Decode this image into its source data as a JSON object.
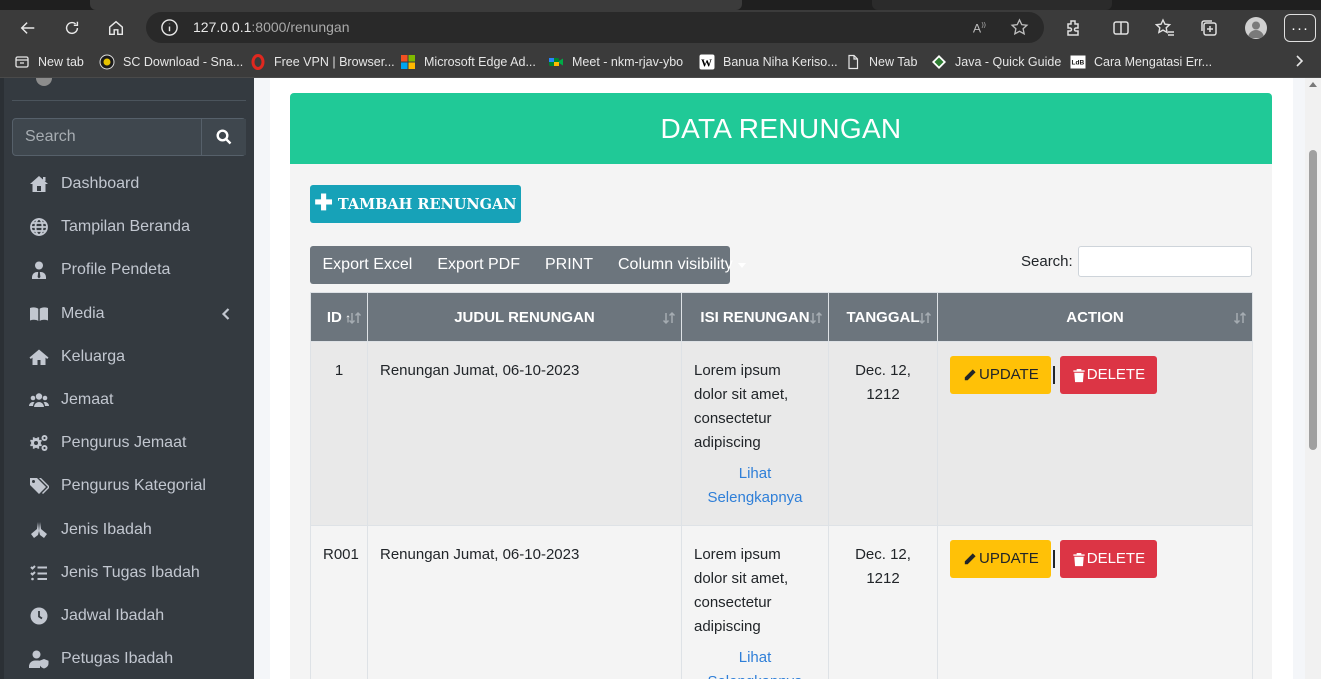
{
  "browser": {
    "url_host": "127.0.0.1",
    "url_path": ":8000/renungan",
    "more_label": "···",
    "bookmarks": [
      {
        "label": "New tab",
        "icon": "newtab-icon"
      },
      {
        "label": "SC Download - Sna...",
        "icon": "sc-download-icon"
      },
      {
        "label": "Free VPN | Browser...",
        "icon": "vpn-icon"
      },
      {
        "label": "Microsoft Edge Ad...",
        "icon": "microsoft-icon"
      },
      {
        "label": "Meet - nkm-rjav-ybo",
        "icon": "meet-icon"
      },
      {
        "label": "Banua Niha Keriso...",
        "icon": "wikipedia-icon"
      },
      {
        "label": "New Tab",
        "icon": "page-icon"
      },
      {
        "label": "Java - Quick Guide",
        "icon": "java-icon"
      },
      {
        "label": "Cara Mengatasi Err...",
        "icon": "sitelogo-icon"
      }
    ]
  },
  "sidebar": {
    "search_placeholder": "Search",
    "items": [
      {
        "label": "Dashboard",
        "icon": "dashboard-icon"
      },
      {
        "label": "Tampilan Beranda",
        "icon": "globe-icon"
      },
      {
        "label": "Profile Pendeta",
        "icon": "user-tie-icon"
      },
      {
        "label": "Media",
        "icon": "book-open-icon"
      },
      {
        "label": "Keluarga",
        "icon": "home-icon"
      },
      {
        "label": "Jemaat",
        "icon": "users-icon"
      },
      {
        "label": "Pengurus Jemaat",
        "icon": "cogs-icon"
      },
      {
        "label": "Pengurus Kategorial",
        "icon": "tags-icon"
      },
      {
        "label": "Jenis Ibadah",
        "icon": "praying-hands-icon"
      },
      {
        "label": "Jenis Tugas Ibadah",
        "icon": "tasks-icon"
      },
      {
        "label": "Jadwal Ibadah",
        "icon": "clock-icon"
      },
      {
        "label": "Petugas Ibadah",
        "icon": "user-shield-icon"
      }
    ]
  },
  "main": {
    "title": "DATA RENUNGAN",
    "add_button": "TAMBAH RENUNGAN",
    "export_buttons": {
      "excel": "Export Excel",
      "pdf": "Export PDF",
      "print": "PRINT",
      "colvis": "Column visibility"
    },
    "search_label": "Search:",
    "search_value": "",
    "columns": [
      "ID",
      "JUDUL RENUNGAN",
      "ISI RENUNGAN",
      "TANGGAL",
      "ACTION"
    ],
    "rows": [
      {
        "id": "1",
        "judul": "Renungan Jumat, 06-10-2023",
        "isi": "Lorem ipsum dolor sit amet, consectetur adipiscing",
        "link": "Lihat Selengkapnya",
        "tanggal": "Dec. 12, 1212",
        "update": "UPDATE",
        "delete": "DELETE"
      },
      {
        "id": "R001",
        "judul": "Renungan Jumat, 06-10-2023",
        "isi": "Lorem ipsum dolor sit amet, consectetur adipiscing",
        "link": "Lihat Selengkapnya",
        "tanggal": "Dec. 12, 1212",
        "update": "UPDATE",
        "delete": "DELETE"
      }
    ]
  },
  "colors": {
    "header_green": "#20c997",
    "add_button": "#17a2b8",
    "update_button": "#ffc107",
    "delete_button": "#dc3545",
    "sidebar": "#343a40",
    "link": "#2f7fd8"
  }
}
